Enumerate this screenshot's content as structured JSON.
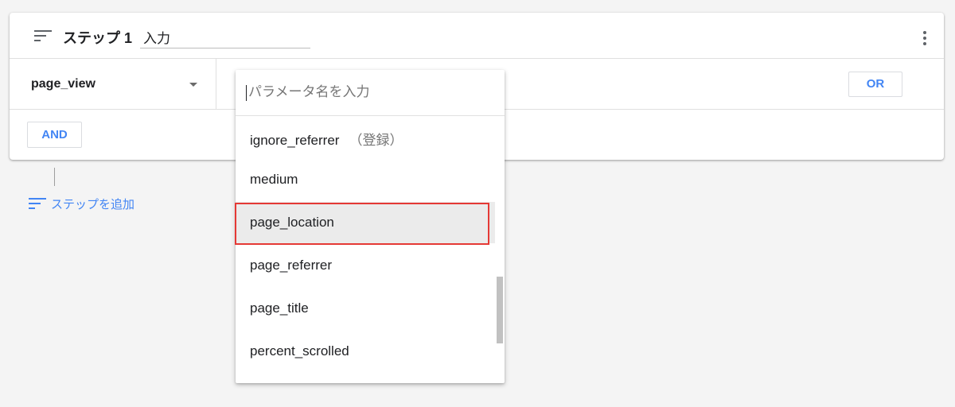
{
  "step": {
    "title": "ステップ 1",
    "name_value": "入力"
  },
  "condition": {
    "event_name": "page_view",
    "or_label": "OR",
    "and_label": "AND"
  },
  "add_step_label": "ステップを追加",
  "dropdown": {
    "search_placeholder": "パラメータ名を入力",
    "items": [
      {
        "label": "ignore_referrer",
        "suffix": "（登録）"
      },
      {
        "label": "medium"
      },
      {
        "label": "page_location",
        "highlighted": true
      },
      {
        "label": "page_referrer"
      },
      {
        "label": "page_title"
      },
      {
        "label": "percent_scrolled"
      }
    ]
  },
  "colors": {
    "accent": "#4285f4",
    "highlight_border": "#e53935",
    "background": "#f4f4f4"
  },
  "icons": [
    "filter-list-icon",
    "more-vert-icon",
    "dropdown-arrow-icon"
  ]
}
